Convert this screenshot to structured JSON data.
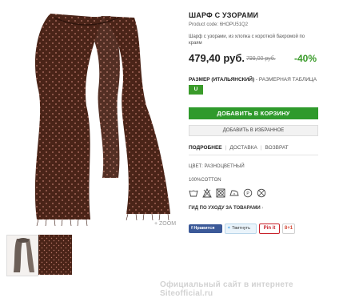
{
  "product": {
    "title": "ШАРФ С УЗОРАМИ",
    "code": "Product code: 6HOPU51Q2",
    "description": "Шарф с узорами, из хлопка с короткой бахромой по краям",
    "price": "479,40 руб.",
    "old_price": "799,00 руб.",
    "discount": "-40%",
    "zoom_label": "+ ZOOM"
  },
  "size": {
    "label": "РАЗМЕР (ИТАЛЬЯНСКИЙ)",
    "separator": " - ",
    "table_link": "РАЗМЕРНАЯ ТАБЛИЦА",
    "selected": "U"
  },
  "actions": {
    "add_to_cart": "ДОБАВИТЬ В КОРЗИНУ",
    "add_to_favorites": "ДОБАВИТЬ В ИЗБРАННОЕ"
  },
  "tabs": [
    {
      "label": "ПОДРОБНЕЕ"
    },
    {
      "label": "ДОСТАВКА"
    },
    {
      "label": "ВОЗВРАТ"
    }
  ],
  "details": {
    "color": "ЦВЕТ: РАЗНОЦВЕТНЫЙ",
    "composition": "100%COTTON",
    "care_link": "ГИД ПО УХОДУ ЗА ТОВАРАМИ",
    "care_chevron": "›"
  },
  "social": {
    "facebook": "Нравится",
    "twitter": "Твитнуть",
    "pinterest": "Pin it",
    "gplus": "8+1"
  },
  "watermark": "Официальный сайт в интернете Siteofficial.ru",
  "colors": {
    "scarf": "#4a2418",
    "accent_green": "#2f9a2c",
    "discount_green": "#3a9b2a"
  }
}
